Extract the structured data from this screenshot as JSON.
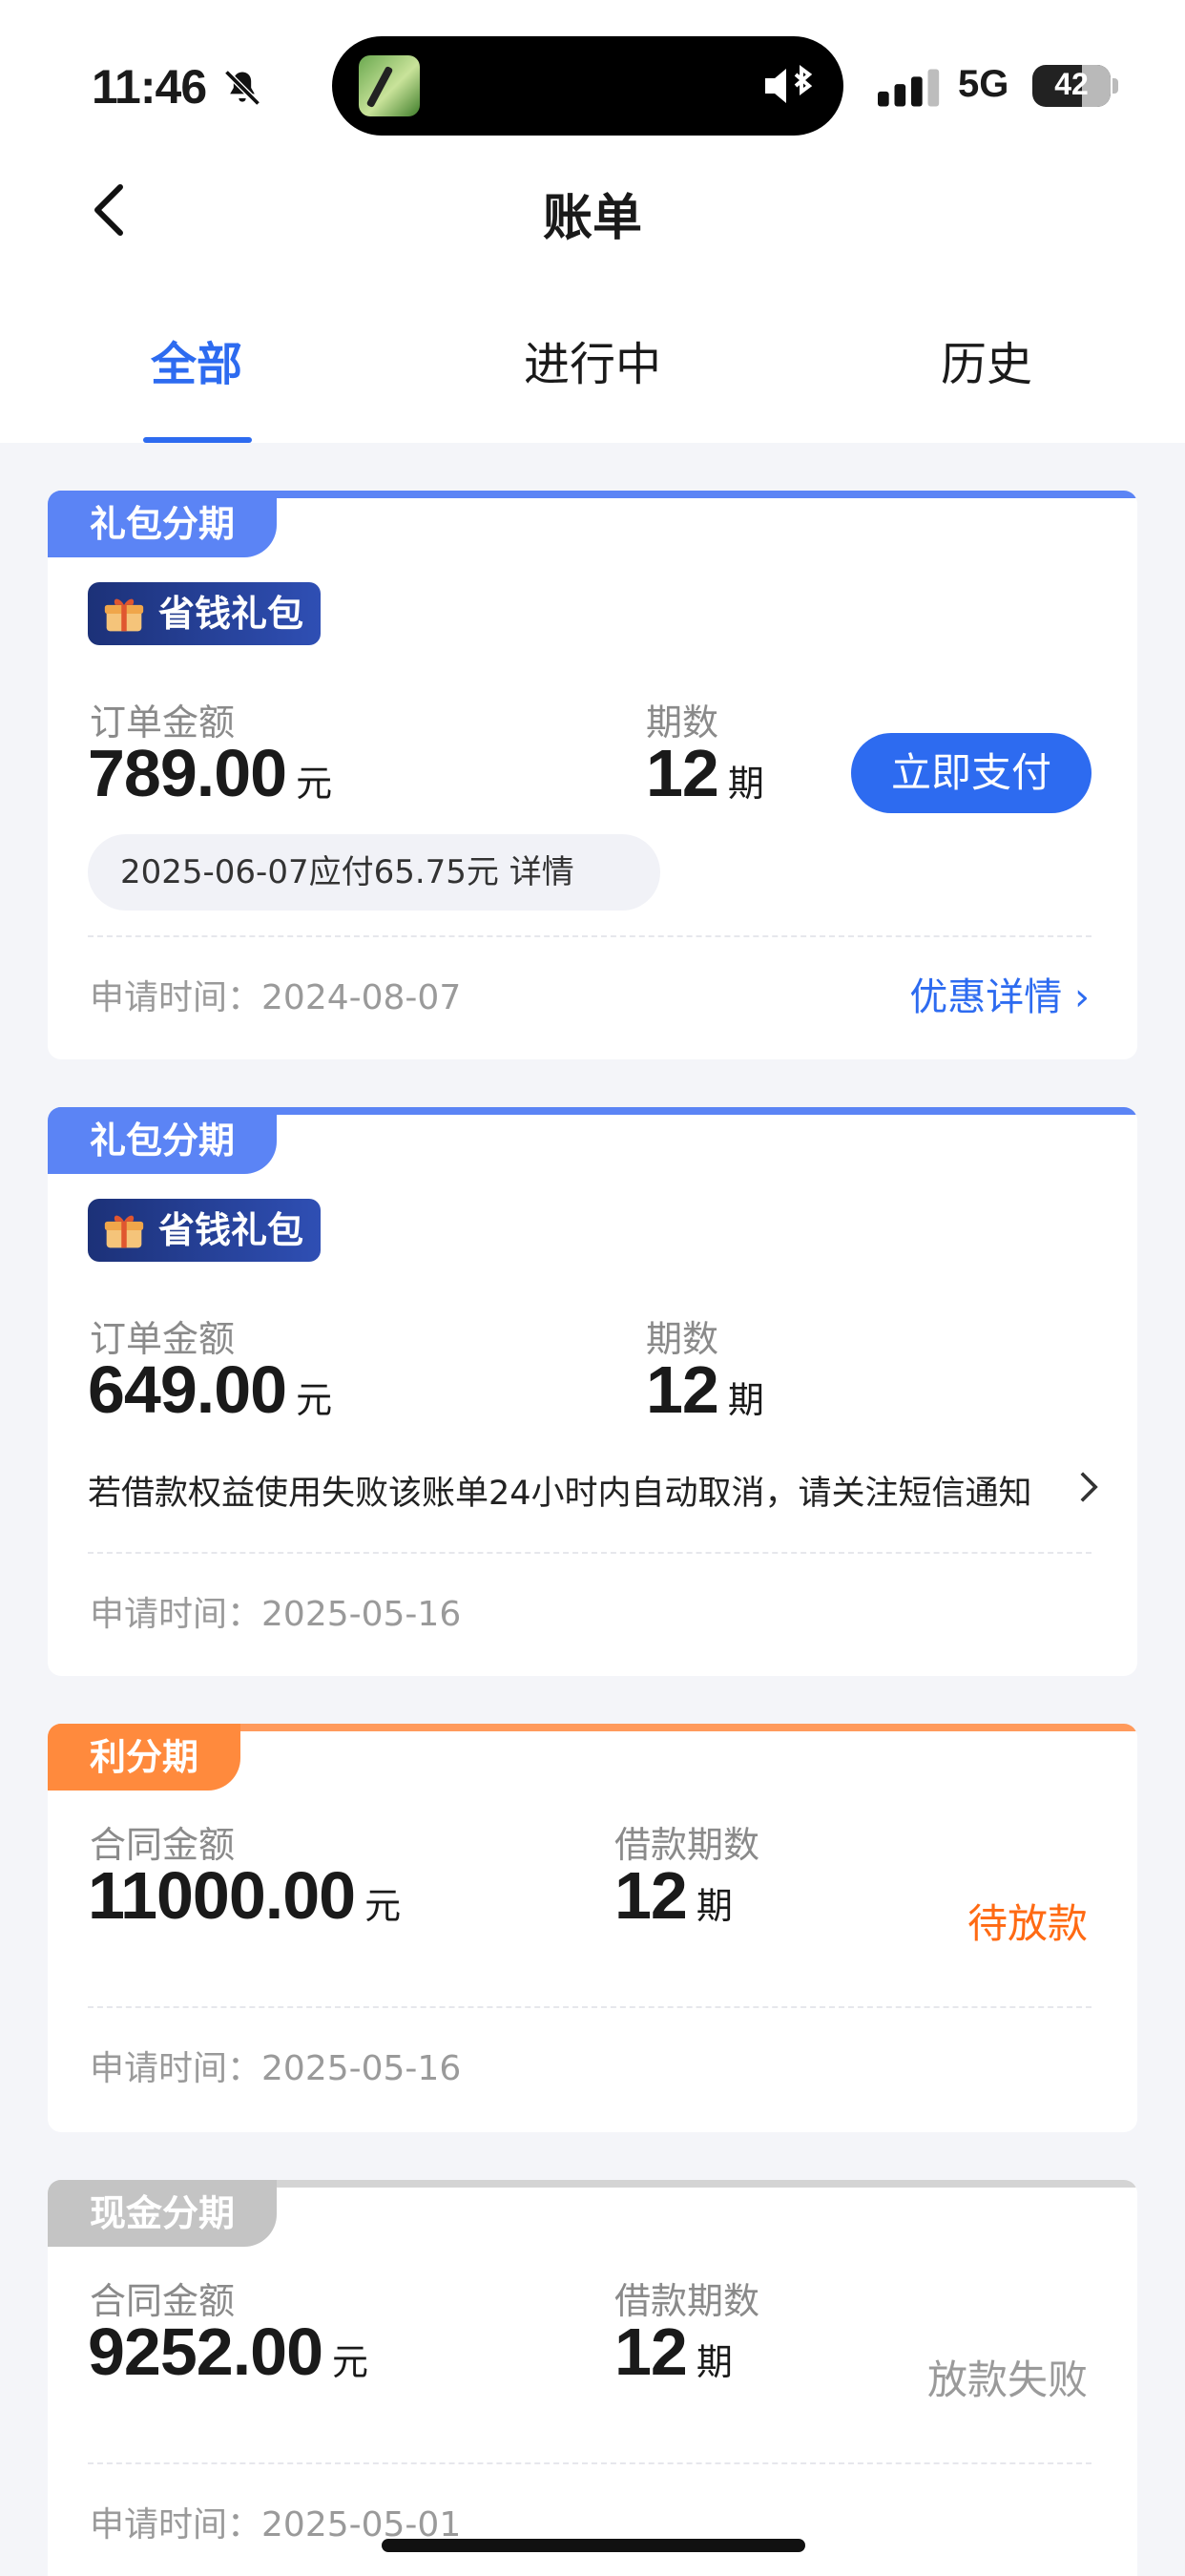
{
  "status_bar": {
    "time": "11:46",
    "network": "5G",
    "battery": "42"
  },
  "nav": {
    "title": "账单"
  },
  "tabs": [
    {
      "label": "全部",
      "active": true
    },
    {
      "label": "进行中",
      "active": false
    },
    {
      "label": "历史",
      "active": false
    }
  ],
  "cards": [
    {
      "tag": "礼包分期",
      "tag_color": "#5b84f5",
      "badge": "省钱礼包",
      "amount_label": "订单金额",
      "amount": "789.00",
      "unit": "元",
      "periods_label": "期数",
      "periods": "12",
      "periods_unit": "期",
      "action": "立即支付",
      "due_text": "2025-06-07应付65.75元 详情",
      "apply_label": "申请时间：",
      "apply_date": "2024-08-07",
      "link": "优惠详情 ›"
    },
    {
      "tag": "礼包分期",
      "tag_color": "#5b84f5",
      "badge": "省钱礼包",
      "amount_label": "订单金额",
      "amount": "649.00",
      "unit": "元",
      "periods_label": "期数",
      "periods": "12",
      "periods_unit": "期",
      "notice": "若借款权益使用失败该账单24小时内自动取消，请关注短信通知",
      "apply_label": "申请时间：",
      "apply_date": "2025-05-16"
    },
    {
      "tag": "利分期",
      "tag_color": "#ff8a3d",
      "amount_label": "合同金额",
      "amount": "11000.00",
      "unit": "元",
      "periods_label": "借款期数",
      "periods": "12",
      "periods_unit": "期",
      "status": "待放款",
      "status_color": "#ff6a13",
      "apply_label": "申请时间：",
      "apply_date": "2025-05-16"
    },
    {
      "tag": "现金分期",
      "tag_color": "#c4c4c4",
      "amount_label": "合同金额",
      "amount": "9252.00",
      "unit": "元",
      "periods_label": "借款期数",
      "periods": "12",
      "periods_unit": "期",
      "status": "放款失败",
      "status_color": "#9a9a9a",
      "apply_label": "申请时间：",
      "apply_date": "2025-05-01"
    }
  ]
}
